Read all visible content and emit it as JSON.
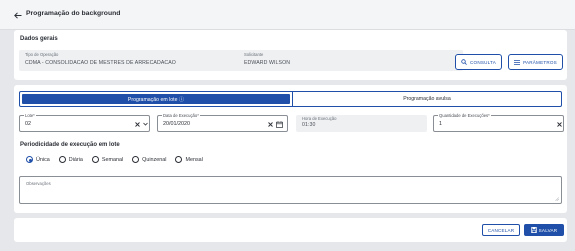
{
  "header": {
    "title": "Programação do background"
  },
  "general": {
    "section_title": "Dados gerais",
    "operation_type": {
      "label": "Tipo de Operação",
      "value": "CDMA - CONSOLIDACAO DE MESTRES DE ARRECADACAO"
    },
    "requester": {
      "label": "Solicitante",
      "value": "EDWARD WILSON"
    },
    "consult_label": "CONSULTA",
    "params_label": "PARÂMETROS"
  },
  "programming": {
    "tabs": [
      {
        "label": "Programação em lote ⓘ",
        "active": true
      },
      {
        "label": "Programação avulsa",
        "active": false
      }
    ],
    "lot": {
      "label": "Lote*",
      "value": "02"
    },
    "exec_date": {
      "label": "Data de Execução*",
      "value": "20/01/2020"
    },
    "exec_time": {
      "label": "Hora de Execução",
      "value": "01:30"
    },
    "exec_count": {
      "label": "Quantidade de Execuções*",
      "value": "1"
    },
    "periodicity_title": "Periodicidade de execução em lote",
    "periodicity_options": [
      {
        "label": "Única",
        "checked": true
      },
      {
        "label": "Diária",
        "checked": false
      },
      {
        "label": "Semanal",
        "checked": false
      },
      {
        "label": "Quinzenal",
        "checked": false
      },
      {
        "label": "Mensal",
        "checked": false
      }
    ],
    "notes_label": "Observações"
  },
  "footer": {
    "cancel_label": "CANCELAR",
    "save_label": "SALVAR"
  },
  "colors": {
    "primary": "#1f4fa8",
    "background": "#e6e7ea",
    "readonly_field": "#eef0f2"
  },
  "icons": {
    "back": "arrow-left-icon",
    "consult": "search-icon",
    "params": "list-icon",
    "clear": "close-icon",
    "dropdown": "chevron-down-icon",
    "calendar": "calendar-icon",
    "save": "save-icon"
  }
}
